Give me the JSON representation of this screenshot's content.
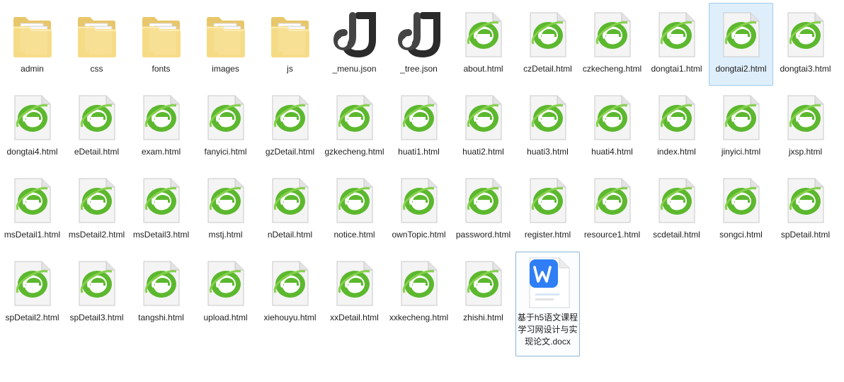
{
  "files": [
    {
      "name": "admin",
      "type": "folder",
      "icon": "folder-icon"
    },
    {
      "name": "css",
      "type": "folder",
      "icon": "folder-icon"
    },
    {
      "name": "fonts",
      "type": "folder",
      "icon": "folder-icon"
    },
    {
      "name": "images",
      "type": "folder",
      "icon": "folder-icon"
    },
    {
      "name": "js",
      "type": "folder",
      "icon": "folder-icon"
    },
    {
      "name": "_menu.json",
      "type": "json",
      "icon": "json-icon"
    },
    {
      "name": "_tree.json",
      "type": "json",
      "icon": "json-icon"
    },
    {
      "name": "about.html",
      "type": "html",
      "icon": "html-browser-icon"
    },
    {
      "name": "czDetail.html",
      "type": "html",
      "icon": "html-browser-icon"
    },
    {
      "name": "czkecheng.html",
      "type": "html",
      "icon": "html-browser-icon"
    },
    {
      "name": "dongtai1.html",
      "type": "html",
      "icon": "html-browser-icon"
    },
    {
      "name": "dongtai2.html",
      "type": "html",
      "icon": "html-browser-icon",
      "selected": true
    },
    {
      "name": "dongtai3.html",
      "type": "html",
      "icon": "html-browser-icon"
    },
    {
      "name": "dongtai4.html",
      "type": "html",
      "icon": "html-browser-icon"
    },
    {
      "name": "eDetail.html",
      "type": "html",
      "icon": "html-browser-icon"
    },
    {
      "name": "exam.html",
      "type": "html",
      "icon": "html-browser-icon"
    },
    {
      "name": "fanyici.html",
      "type": "html",
      "icon": "html-browser-icon"
    },
    {
      "name": "gzDetail.html",
      "type": "html",
      "icon": "html-browser-icon"
    },
    {
      "name": "gzkecheng.html",
      "type": "html",
      "icon": "html-browser-icon"
    },
    {
      "name": "huati1.html",
      "type": "html",
      "icon": "html-browser-icon"
    },
    {
      "name": "huati2.html",
      "type": "html",
      "icon": "html-browser-icon"
    },
    {
      "name": "huati3.html",
      "type": "html",
      "icon": "html-browser-icon"
    },
    {
      "name": "huati4.html",
      "type": "html",
      "icon": "html-browser-icon"
    },
    {
      "name": "index.html",
      "type": "html",
      "icon": "html-browser-icon"
    },
    {
      "name": "jinyici.html",
      "type": "html",
      "icon": "html-browser-icon"
    },
    {
      "name": "jxsp.html",
      "type": "html",
      "icon": "html-browser-icon"
    },
    {
      "name": "msDetail1.html",
      "type": "html",
      "icon": "html-browser-icon"
    },
    {
      "name": "msDetail2.html",
      "type": "html",
      "icon": "html-browser-icon"
    },
    {
      "name": "msDetail3.html",
      "type": "html",
      "icon": "html-browser-icon"
    },
    {
      "name": "mstj.html",
      "type": "html",
      "icon": "html-browser-icon"
    },
    {
      "name": "nDetail.html",
      "type": "html",
      "icon": "html-browser-icon"
    },
    {
      "name": "notice.html",
      "type": "html",
      "icon": "html-browser-icon"
    },
    {
      "name": "ownTopic.html",
      "type": "html",
      "icon": "html-browser-icon"
    },
    {
      "name": "password.html",
      "type": "html",
      "icon": "html-browser-icon"
    },
    {
      "name": "register.html",
      "type": "html",
      "icon": "html-browser-icon"
    },
    {
      "name": "resource1.html",
      "type": "html",
      "icon": "html-browser-icon"
    },
    {
      "name": "scdetail.html",
      "type": "html",
      "icon": "html-browser-icon"
    },
    {
      "name": "songci.html",
      "type": "html",
      "icon": "html-browser-icon"
    },
    {
      "name": "spDetail.html",
      "type": "html",
      "icon": "html-browser-icon"
    },
    {
      "name": "spDetail2.html",
      "type": "html",
      "icon": "html-browser-icon"
    },
    {
      "name": "spDetail3.html",
      "type": "html",
      "icon": "html-browser-icon"
    },
    {
      "name": "tangshi.html",
      "type": "html",
      "icon": "html-browser-icon"
    },
    {
      "name": "upload.html",
      "type": "html",
      "icon": "html-browser-icon"
    },
    {
      "name": "xiehouyu.html",
      "type": "html",
      "icon": "html-browser-icon"
    },
    {
      "name": "xxDetail.html",
      "type": "html",
      "icon": "html-browser-icon"
    },
    {
      "name": "xxkecheng.html",
      "type": "html",
      "icon": "html-browser-icon"
    },
    {
      "name": "zhishi.html",
      "type": "html",
      "icon": "html-browser-icon"
    },
    {
      "name": "基于h5语文课程学习网设计与实现论文.docx",
      "type": "docx",
      "icon": "wps-docx-icon",
      "boxed": true
    }
  ],
  "colors": {
    "selected_bg": "#dfeefb",
    "selected_border": "#9fcbf0",
    "browser_green": "#5cb82e",
    "wps_blue": "#2f7ef5"
  }
}
